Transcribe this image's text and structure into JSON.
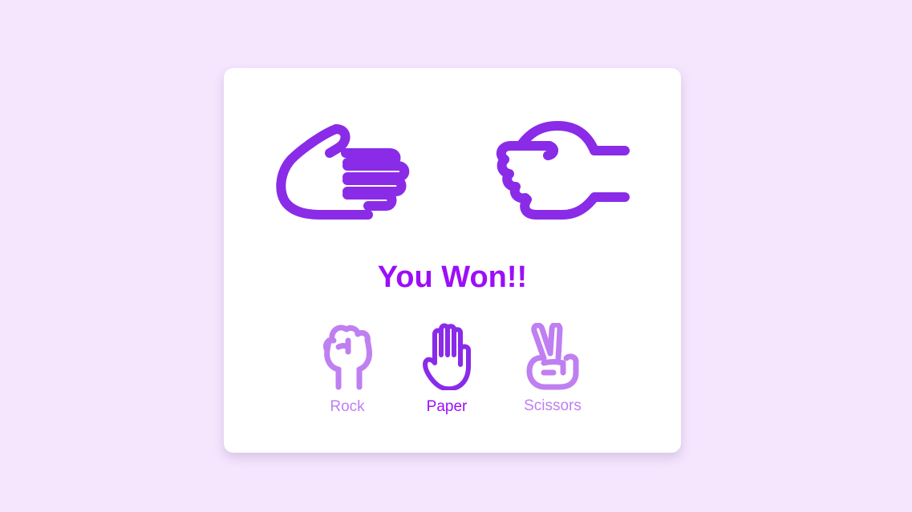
{
  "game": {
    "result_text": "You Won!!",
    "user_choice": "paper",
    "computer_choice": "scissors"
  },
  "options": [
    {
      "id": "rock",
      "label": "Rock",
      "icon": "rock-icon",
      "selected": false
    },
    {
      "id": "paper",
      "label": "Paper",
      "icon": "paper-icon",
      "selected": true
    },
    {
      "id": "scissors",
      "label": "Scissors",
      "icon": "scissors-icon",
      "selected": false
    }
  ],
  "colors": {
    "background": "#f5e6fe",
    "card": "#ffffff",
    "accent": "#8a2be8",
    "result_text": "#9c0ef9",
    "inactive": "#bf7ff1"
  }
}
